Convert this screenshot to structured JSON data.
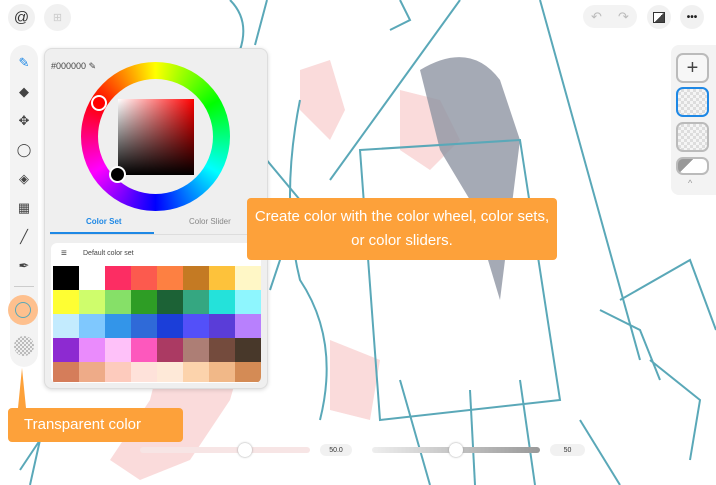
{
  "top_left": {
    "logo_icon": "spiral-logo-icon",
    "import_icon": "import-icon"
  },
  "top_right": {
    "undo_icon": "undo-icon",
    "redo_icon": "redo-icon",
    "gallery_icon": "gallery-icon",
    "more_label": "•••"
  },
  "toolbar": {
    "tools": [
      "pen",
      "eraser",
      "move",
      "lasso",
      "fill",
      "grid",
      "line",
      "eyedropper"
    ]
  },
  "color_picker": {
    "hex": "#000000",
    "tabs": [
      {
        "label": "Color Set",
        "active": true
      },
      {
        "label": "Color Slider",
        "active": false
      }
    ],
    "color_set_name": "Default color set",
    "swatches": [
      "#000000",
      "#ffffff",
      "#fc2d63",
      "#fc5a4e",
      "#fd8042",
      "#c47a23",
      "#fdc23b",
      "#fff7c6",
      "#fefe33",
      "#cffd6c",
      "#86e068",
      "#2e9d25",
      "#1c6236",
      "#35a781",
      "#24e2da",
      "#8ef6fe",
      "#c3ebfe",
      "#7fc8fe",
      "#3395e9",
      "#2f6ad8",
      "#1b3ed9",
      "#5350f9",
      "#5a3dd8",
      "#b880fd",
      "#8d2ad1",
      "#ea8bfc",
      "#fec1f9",
      "#fd58bd",
      "#ab3a63",
      "#ad7e75",
      "#744b3d",
      "#48382a",
      "#d57d5a",
      "#eeab88",
      "#fdcbbd",
      "#fee2da",
      "#fee9d8",
      "#fcd3ac",
      "#f1b888",
      "#d48b55"
    ]
  },
  "callouts": {
    "main": "Create color with the color wheel, color sets, or color sliders.",
    "transparent": "Transparent color"
  },
  "sliders": {
    "size_value": "50.0",
    "size_fraction": 0.62,
    "opacity_value": "50",
    "opacity_fraction": 0.5
  },
  "colors": {
    "accent": "#1e88e5",
    "callout": "#fda13a",
    "line_art": "#5aa8b8",
    "skin": "#fadada"
  }
}
